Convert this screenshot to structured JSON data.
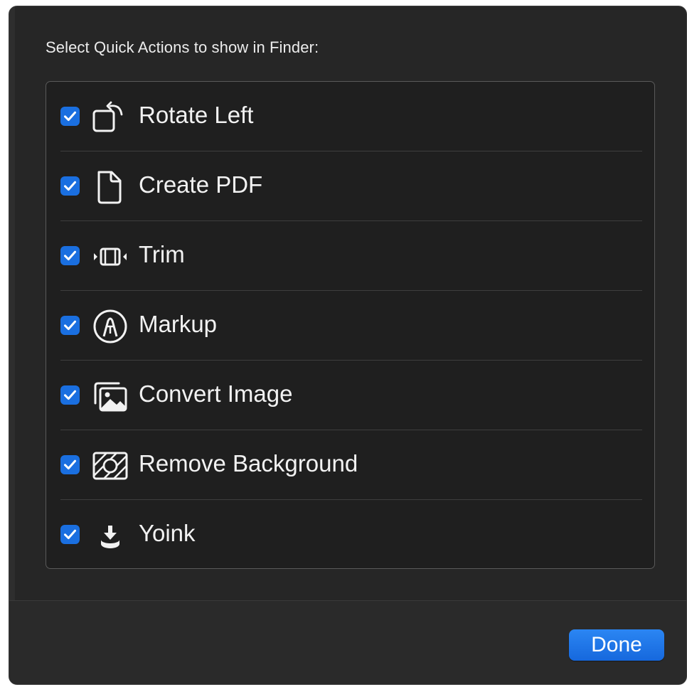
{
  "dialog": {
    "prompt": "Select Quick Actions to show in Finder:",
    "done_label": "Done",
    "accent_color": "#1a6fe0"
  },
  "actions": [
    {
      "label": "Rotate Left",
      "checked": true,
      "icon": "rotate-left-icon"
    },
    {
      "label": "Create PDF",
      "checked": true,
      "icon": "document-icon"
    },
    {
      "label": "Trim",
      "checked": true,
      "icon": "trim-icon"
    },
    {
      "label": "Markup",
      "checked": true,
      "icon": "markup-pen-icon"
    },
    {
      "label": "Convert Image",
      "checked": true,
      "icon": "photos-icon"
    },
    {
      "label": "Remove Background",
      "checked": true,
      "icon": "remove-background-icon"
    },
    {
      "label": "Yoink",
      "checked": true,
      "icon": "yoink-tray-icon"
    }
  ]
}
